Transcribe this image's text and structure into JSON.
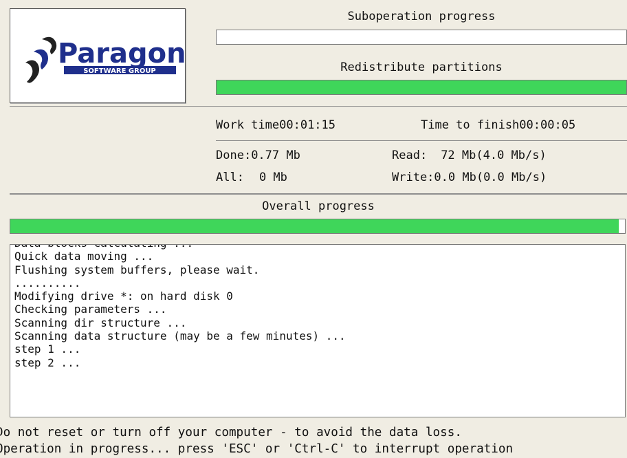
{
  "logo": {
    "name": "Paragon",
    "tagline": "SOFTWARE GROUP",
    "colors": {
      "brand_blue": "#1f2f8c",
      "mark_dark": "#222222"
    }
  },
  "suboperation": {
    "title": "Suboperation progress",
    "progress": 0.0,
    "current_label": "Redistribute partitions",
    "current_progress": 1.0
  },
  "times": {
    "work_label": "Work time",
    "work_value": "00:01:15",
    "finish_label": "Time to finish",
    "finish_value": "00:00:05"
  },
  "stats": {
    "done_label": "Done:",
    "done_value": "0.77 Mb",
    "all_label": "All:",
    "all_value": "0 Mb",
    "read_label": "Read:",
    "read_value": "72 Mb(4.0 Mb/s)",
    "write_label": "Write:",
    "write_value": "0.0 Mb(0.0 Mb/s)"
  },
  "overall": {
    "title": "Overall progress",
    "progress": 0.99
  },
  "log": [
    "Data blocks calculating ...",
    "Quick data moving ...",
    "Flushing system buffers, please wait.",
    "..........",
    "Modifying drive *: on hard disk 0",
    "Checking parameters ...",
    "Scanning dir structure ...",
    "Scanning data structure (may be a few minutes) ...",
    "step 1 ...",
    "step 2 ..."
  ],
  "footer": {
    "warning": "Do not reset or turn off your computer - to avoid the data loss.",
    "status": "Operation in progress... press 'ESC' or 'Ctrl-C' to interrupt operation"
  },
  "colors": {
    "progress_fill": "#3fd65a",
    "background": "#f0ede3"
  }
}
